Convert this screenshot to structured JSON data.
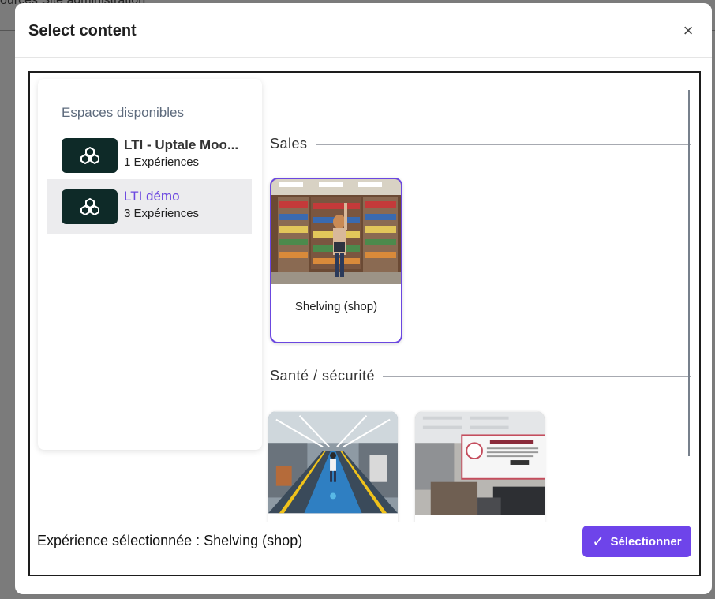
{
  "background": {
    "breadcrumb": "ources   Site administration"
  },
  "modal": {
    "title": "Select content",
    "close_glyph": "×"
  },
  "sidebar": {
    "heading": "Espaces disponibles",
    "items": [
      {
        "name": "LTI - Uptale Moo...",
        "count": "1 Expériences",
        "icon": "cubes-icon",
        "active": false
      },
      {
        "name": "LTI démo",
        "count": "3 Expériences",
        "icon": "cubes-icon",
        "active": true
      }
    ]
  },
  "sections": [
    {
      "label": "Sales",
      "cards": [
        {
          "title": "Shelving (shop)",
          "image": "bookstore-shelving-photo",
          "selected": true
        }
      ]
    },
    {
      "label": "Santé / sécurité",
      "cards": [
        {
          "title": "",
          "image": "factory-walkway-photo",
          "selected": false
        },
        {
          "title": "",
          "image": "office-safety-sign-photo",
          "selected": false
        }
      ]
    }
  ],
  "footer": {
    "selected_text": "Expérience sélectionnée : Shelving (shop)",
    "select_button_label": "Sélectionner",
    "select_button_icon": "check-icon"
  },
  "colors": {
    "accent": "#6e44ea",
    "active_item_bg": "#ececee",
    "icon_bg": "#0e2a28"
  }
}
